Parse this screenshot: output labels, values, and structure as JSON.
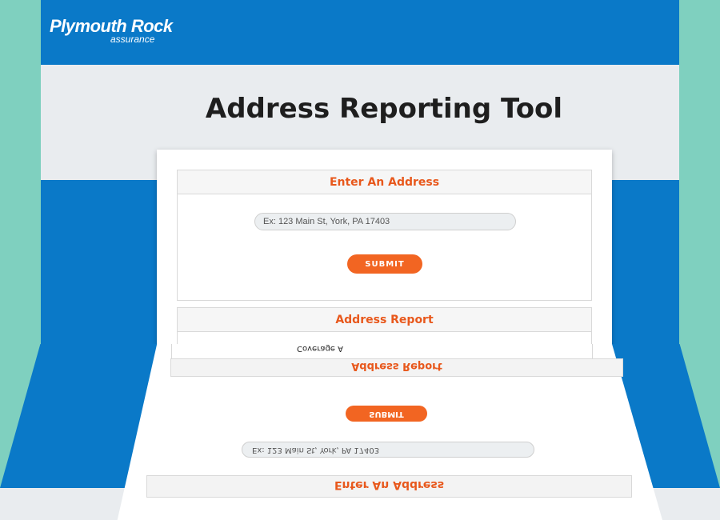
{
  "brand": {
    "name": "Plymouth Rock",
    "sub": "assurance"
  },
  "page": {
    "title": "Address Reporting Tool"
  },
  "enter_panel": {
    "heading": "Enter An Address",
    "placeholder": "Ex: 123 Main St, York, PA 17403",
    "submit_label": "SUBMIT"
  },
  "report_panel": {
    "heading": "Address Report",
    "first_label": "Coverage A"
  },
  "colors": {
    "accent": "#f26522",
    "heading": "#e8581c",
    "brand_blue": "#0a79c8",
    "background": "#7fd0bf"
  }
}
